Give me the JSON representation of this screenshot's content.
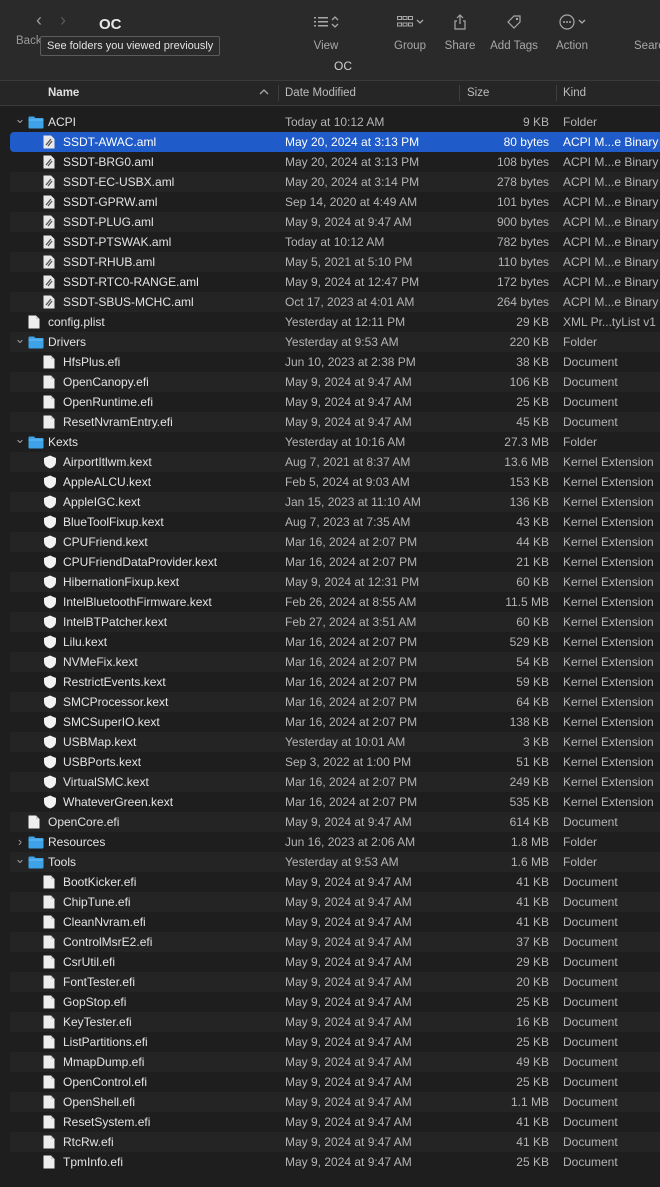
{
  "window": {
    "title": "OC",
    "path_title": "OC",
    "back_label": "Back",
    "tooltip": "See folders you viewed previously"
  },
  "toolbar": {
    "view_label": "View",
    "group_label": "Group",
    "share_label": "Share",
    "tags_label": "Add Tags",
    "action_label": "Action",
    "search_label": "Search"
  },
  "columns": {
    "name": "Name",
    "date": "Date Modified",
    "size": "Size",
    "kind": "Kind"
  },
  "rows": [
    {
      "name": "ACPI",
      "date": "Today at 10:12 AM",
      "size": "9 KB",
      "kind": "Folder",
      "depth": 0,
      "type": "folder",
      "disclosure": "open"
    },
    {
      "name": "SSDT-AWAC.aml",
      "date": "May 20, 2024 at 3:13 PM",
      "size": "80 bytes",
      "kind": "ACPI M...e Binary",
      "depth": 1,
      "type": "aml",
      "selected": true
    },
    {
      "name": "SSDT-BRG0.aml",
      "date": "May 20, 2024 at 3:13 PM",
      "size": "108 bytes",
      "kind": "ACPI M...e Binary",
      "depth": 1,
      "type": "aml"
    },
    {
      "name": "SSDT-EC-USBX.aml",
      "date": "May 20, 2024 at 3:14 PM",
      "size": "278 bytes",
      "kind": "ACPI M...e Binary",
      "depth": 1,
      "type": "aml"
    },
    {
      "name": "SSDT-GPRW.aml",
      "date": "Sep 14, 2020 at 4:49 AM",
      "size": "101 bytes",
      "kind": "ACPI M...e Binary",
      "depth": 1,
      "type": "aml"
    },
    {
      "name": "SSDT-PLUG.aml",
      "date": "May 9, 2024 at 9:47 AM",
      "size": "900 bytes",
      "kind": "ACPI M...e Binary",
      "depth": 1,
      "type": "aml"
    },
    {
      "name": "SSDT-PTSWAK.aml",
      "date": "Today at 10:12 AM",
      "size": "782 bytes",
      "kind": "ACPI M...e Binary",
      "depth": 1,
      "type": "aml"
    },
    {
      "name": "SSDT-RHUB.aml",
      "date": "May 5, 2021 at 5:10 PM",
      "size": "110 bytes",
      "kind": "ACPI M...e Binary",
      "depth": 1,
      "type": "aml"
    },
    {
      "name": "SSDT-RTC0-RANGE.aml",
      "date": "May 9, 2024 at 12:47 PM",
      "size": "172 bytes",
      "kind": "ACPI M...e Binary",
      "depth": 1,
      "type": "aml"
    },
    {
      "name": "SSDT-SBUS-MCHC.aml",
      "date": "Oct 17, 2023 at 4:01 AM",
      "size": "264 bytes",
      "kind": "ACPI M...e Binary",
      "depth": 1,
      "type": "aml"
    },
    {
      "name": "config.plist",
      "date": "Yesterday at 12:11 PM",
      "size": "29 KB",
      "kind": "XML Pr...tyList v1",
      "depth": 0,
      "type": "doc"
    },
    {
      "name": "Drivers",
      "date": "Yesterday at 9:53 AM",
      "size": "220 KB",
      "kind": "Folder",
      "depth": 0,
      "type": "folder",
      "disclosure": "open"
    },
    {
      "name": "HfsPlus.efi",
      "date": "Jun 10, 2023 at 2:38 PM",
      "size": "38 KB",
      "kind": "Document",
      "depth": 1,
      "type": "doc"
    },
    {
      "name": "OpenCanopy.efi",
      "date": "May 9, 2024 at 9:47 AM",
      "size": "106 KB",
      "kind": "Document",
      "depth": 1,
      "type": "doc"
    },
    {
      "name": "OpenRuntime.efi",
      "date": "May 9, 2024 at 9:47 AM",
      "size": "25 KB",
      "kind": "Document",
      "depth": 1,
      "type": "doc"
    },
    {
      "name": "ResetNvramEntry.efi",
      "date": "May 9, 2024 at 9:47 AM",
      "size": "45 KB",
      "kind": "Document",
      "depth": 1,
      "type": "doc"
    },
    {
      "name": "Kexts",
      "date": "Yesterday at 10:16 AM",
      "size": "27.3 MB",
      "kind": "Folder",
      "depth": 0,
      "type": "folder",
      "disclosure": "open"
    },
    {
      "name": "AirportItlwm.kext",
      "date": "Aug 7, 2021 at 8:37 AM",
      "size": "13.6 MB",
      "kind": "Kernel Extension",
      "depth": 1,
      "type": "kext"
    },
    {
      "name": "AppleALCU.kext",
      "date": "Feb 5, 2024 at 9:03 AM",
      "size": "153 KB",
      "kind": "Kernel Extension",
      "depth": 1,
      "type": "kext"
    },
    {
      "name": "AppleIGC.kext",
      "date": "Jan 15, 2023 at 11:10 AM",
      "size": "136 KB",
      "kind": "Kernel Extension",
      "depth": 1,
      "type": "kext"
    },
    {
      "name": "BlueToolFixup.kext",
      "date": "Aug 7, 2023 at 7:35 AM",
      "size": "43 KB",
      "kind": "Kernel Extension",
      "depth": 1,
      "type": "kext"
    },
    {
      "name": "CPUFriend.kext",
      "date": "Mar 16, 2024 at 2:07 PM",
      "size": "44 KB",
      "kind": "Kernel Extension",
      "depth": 1,
      "type": "kext"
    },
    {
      "name": "CPUFriendDataProvider.kext",
      "date": "Mar 16, 2024 at 2:07 PM",
      "size": "21 KB",
      "kind": "Kernel Extension",
      "depth": 1,
      "type": "kext"
    },
    {
      "name": "HibernationFixup.kext",
      "date": "May 9, 2024 at 12:31 PM",
      "size": "60 KB",
      "kind": "Kernel Extension",
      "depth": 1,
      "type": "kext"
    },
    {
      "name": "IntelBluetoothFirmware.kext",
      "date": "Feb 26, 2024 at 8:55 AM",
      "size": "11.5 MB",
      "kind": "Kernel Extension",
      "depth": 1,
      "type": "kext"
    },
    {
      "name": "IntelBTPatcher.kext",
      "date": "Feb 27, 2024 at 3:51 AM",
      "size": "60 KB",
      "kind": "Kernel Extension",
      "depth": 1,
      "type": "kext"
    },
    {
      "name": "Lilu.kext",
      "date": "Mar 16, 2024 at 2:07 PM",
      "size": "529 KB",
      "kind": "Kernel Extension",
      "depth": 1,
      "type": "kext"
    },
    {
      "name": "NVMeFix.kext",
      "date": "Mar 16, 2024 at 2:07 PM",
      "size": "54 KB",
      "kind": "Kernel Extension",
      "depth": 1,
      "type": "kext"
    },
    {
      "name": "RestrictEvents.kext",
      "date": "Mar 16, 2024 at 2:07 PM",
      "size": "59 KB",
      "kind": "Kernel Extension",
      "depth": 1,
      "type": "kext"
    },
    {
      "name": "SMCProcessor.kext",
      "date": "Mar 16, 2024 at 2:07 PM",
      "size": "64 KB",
      "kind": "Kernel Extension",
      "depth": 1,
      "type": "kext"
    },
    {
      "name": "SMCSuperIO.kext",
      "date": "Mar 16, 2024 at 2:07 PM",
      "size": "138 KB",
      "kind": "Kernel Extension",
      "depth": 1,
      "type": "kext"
    },
    {
      "name": "USBMap.kext",
      "date": "Yesterday at 10:01 AM",
      "size": "3 KB",
      "kind": "Kernel Extension",
      "depth": 1,
      "type": "kext"
    },
    {
      "name": "USBPorts.kext",
      "date": "Sep 3, 2022 at 1:00 PM",
      "size": "51 KB",
      "kind": "Kernel Extension",
      "depth": 1,
      "type": "kext"
    },
    {
      "name": "VirtualSMC.kext",
      "date": "Mar 16, 2024 at 2:07 PM",
      "size": "249 KB",
      "kind": "Kernel Extension",
      "depth": 1,
      "type": "kext"
    },
    {
      "name": "WhateverGreen.kext",
      "date": "Mar 16, 2024 at 2:07 PM",
      "size": "535 KB",
      "kind": "Kernel Extension",
      "depth": 1,
      "type": "kext"
    },
    {
      "name": "OpenCore.efi",
      "date": "May 9, 2024 at 9:47 AM",
      "size": "614 KB",
      "kind": "Document",
      "depth": 0,
      "type": "doc"
    },
    {
      "name": "Resources",
      "date": "Jun 16, 2023 at 2:06 AM",
      "size": "1.8 MB",
      "kind": "Folder",
      "depth": 0,
      "type": "folder",
      "disclosure": "closed"
    },
    {
      "name": "Tools",
      "date": "Yesterday at 9:53 AM",
      "size": "1.6 MB",
      "kind": "Folder",
      "depth": 0,
      "type": "folder",
      "disclosure": "open"
    },
    {
      "name": "BootKicker.efi",
      "date": "May 9, 2024 at 9:47 AM",
      "size": "41 KB",
      "kind": "Document",
      "depth": 1,
      "type": "doc"
    },
    {
      "name": "ChipTune.efi",
      "date": "May 9, 2024 at 9:47 AM",
      "size": "41 KB",
      "kind": "Document",
      "depth": 1,
      "type": "doc"
    },
    {
      "name": "CleanNvram.efi",
      "date": "May 9, 2024 at 9:47 AM",
      "size": "41 KB",
      "kind": "Document",
      "depth": 1,
      "type": "doc"
    },
    {
      "name": "ControlMsrE2.efi",
      "date": "May 9, 2024 at 9:47 AM",
      "size": "37 KB",
      "kind": "Document",
      "depth": 1,
      "type": "doc"
    },
    {
      "name": "CsrUtil.efi",
      "date": "May 9, 2024 at 9:47 AM",
      "size": "29 KB",
      "kind": "Document",
      "depth": 1,
      "type": "doc"
    },
    {
      "name": "FontTester.efi",
      "date": "May 9, 2024 at 9:47 AM",
      "size": "20 KB",
      "kind": "Document",
      "depth": 1,
      "type": "doc"
    },
    {
      "name": "GopStop.efi",
      "date": "May 9, 2024 at 9:47 AM",
      "size": "25 KB",
      "kind": "Document",
      "depth": 1,
      "type": "doc"
    },
    {
      "name": "KeyTester.efi",
      "date": "May 9, 2024 at 9:47 AM",
      "size": "16 KB",
      "kind": "Document",
      "depth": 1,
      "type": "doc"
    },
    {
      "name": "ListPartitions.efi",
      "date": "May 9, 2024 at 9:47 AM",
      "size": "25 KB",
      "kind": "Document",
      "depth": 1,
      "type": "doc"
    },
    {
      "name": "MmapDump.efi",
      "date": "May 9, 2024 at 9:47 AM",
      "size": "49 KB",
      "kind": "Document",
      "depth": 1,
      "type": "doc"
    },
    {
      "name": "OpenControl.efi",
      "date": "May 9, 2024 at 9:47 AM",
      "size": "25 KB",
      "kind": "Document",
      "depth": 1,
      "type": "doc"
    },
    {
      "name": "OpenShell.efi",
      "date": "May 9, 2024 at 9:47 AM",
      "size": "1.1 MB",
      "kind": "Document",
      "depth": 1,
      "type": "doc"
    },
    {
      "name": "ResetSystem.efi",
      "date": "May 9, 2024 at 9:47 AM",
      "size": "41 KB",
      "kind": "Document",
      "depth": 1,
      "type": "doc"
    },
    {
      "name": "RtcRw.efi",
      "date": "May 9, 2024 at 9:47 AM",
      "size": "41 KB",
      "kind": "Document",
      "depth": 1,
      "type": "doc"
    },
    {
      "name": "TpmInfo.efi",
      "date": "May 9, 2024 at 9:47 AM",
      "size": "25 KB",
      "kind": "Document",
      "depth": 1,
      "type": "doc"
    }
  ],
  "icons": {
    "folder": "folder-icon",
    "aml": "aml-file-icon",
    "doc": "document-icon",
    "kext": "kext-icon"
  },
  "colors": {
    "selection": "#1f5bc9",
    "folder": "#3ea2e8",
    "background": "#1e1e1e"
  }
}
